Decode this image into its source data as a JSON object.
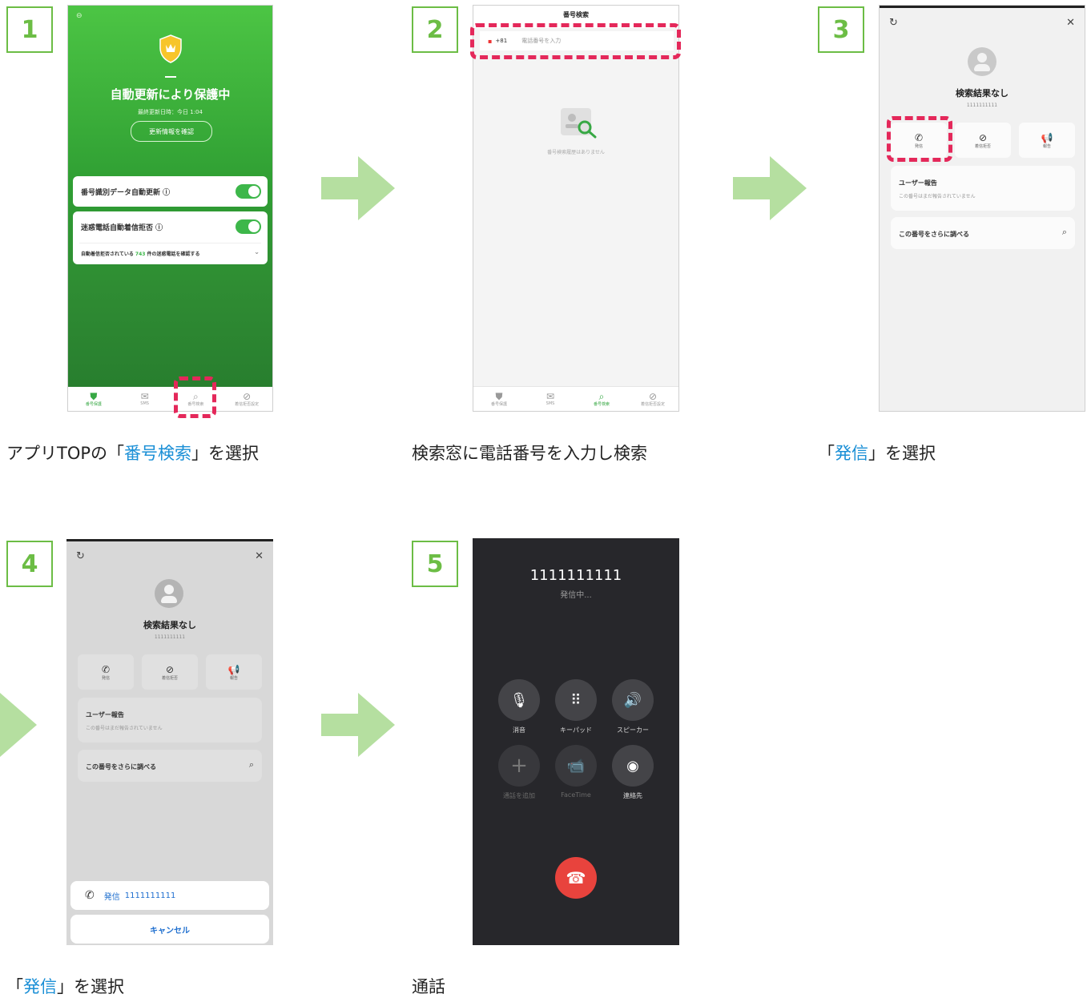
{
  "steps": [
    {
      "num": "1",
      "caption_pre": "アプリTOPの「",
      "caption_hl": "番号検索",
      "caption_post": "」を選択"
    },
    {
      "num": "2",
      "caption": "検索窓に電話番号を入力し検索"
    },
    {
      "num": "3",
      "caption_pre": "「",
      "caption_hl": "発信",
      "caption_post": "」を選択"
    },
    {
      "num": "4",
      "caption_pre": "「",
      "caption_hl": "発信",
      "caption_post": "」を選択"
    },
    {
      "num": "5",
      "caption": "通話"
    }
  ],
  "screen1": {
    "title": "自動更新により保護中",
    "sub": "最終更新日時：今日 1:04",
    "pill": "更新情報を確認",
    "row1": "番号識別データ自動更新 ⓘ",
    "row2": "迷惑電話自動着信拒否 ⓘ",
    "row3_pre": "自動着信拒否されている ",
    "row3_count": "743",
    "row3_post": " 件の迷惑電話を確認する",
    "nav": [
      "番号保護",
      "SMS",
      "番号検索",
      "着信拒否設定"
    ]
  },
  "screen2": {
    "header": "番号検索",
    "country_code": "+81",
    "placeholder": "電話番号を入力",
    "empty": "番号検索履歴はありません",
    "nav": [
      "番号保護",
      "SMS",
      "番号検索",
      "着信拒否設定"
    ]
  },
  "screen3": {
    "title": "検索結果なし",
    "number": "1111111111",
    "actions": [
      "発信",
      "着信拒否",
      "報告"
    ],
    "user_report_title": "ユーザー報告",
    "user_report_sub": "この番号はまだ報告されていません",
    "search_more": "この番号をさらに調べる"
  },
  "screen4": {
    "call_label": "発信",
    "call_number": "1111111111",
    "cancel": "キャンセル"
  },
  "screen5": {
    "number": "1111111111",
    "status": "発信中...",
    "buttons": [
      "消音",
      "キーパッド",
      "スピーカー",
      "通話を追加",
      "FaceTime",
      "連絡先"
    ]
  },
  "colors": {
    "accent_green": "#6cbd45",
    "highlight_blue": "#1a8fd6",
    "dash_red": "#e4285a",
    "arrow_green": "#b5dfa0",
    "end_call_red": "#e8433d"
  }
}
